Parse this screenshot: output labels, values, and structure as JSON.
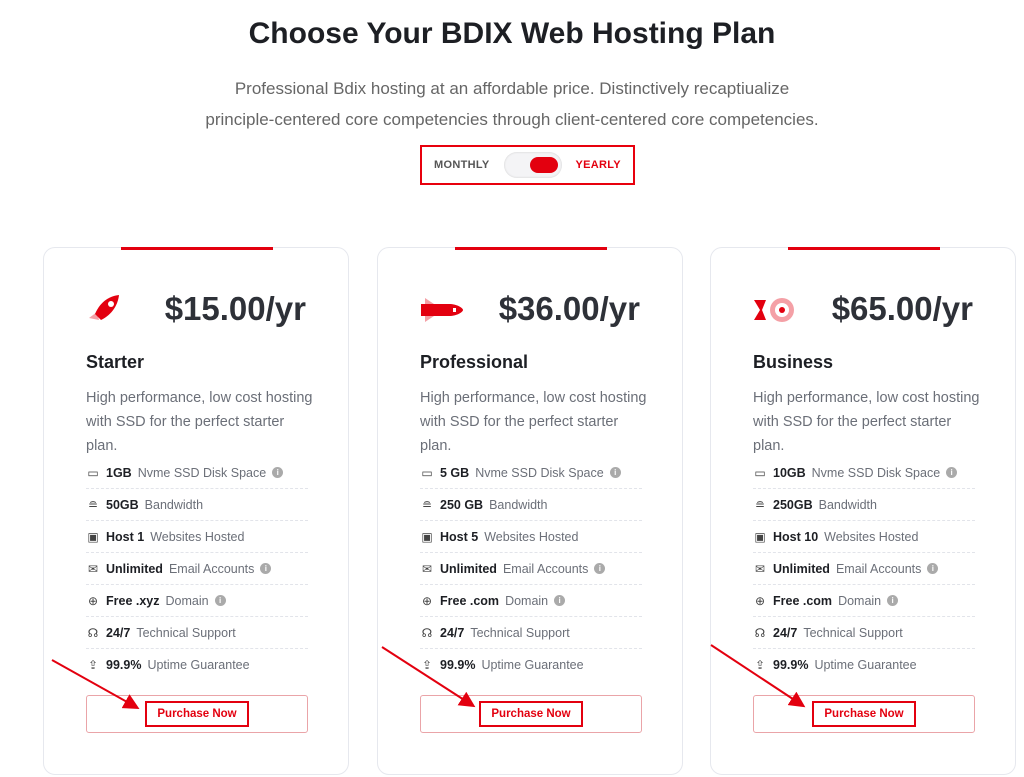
{
  "header": {
    "title": "Choose Your BDIX Web Hosting Plan",
    "subtitle_line1": "Professional Bdix hosting at an affordable price. Distinctively recaptiualize",
    "subtitle_line2": "principle-centered core competencies through client-centered core competencies."
  },
  "billing_toggle": {
    "monthly": "MONTHLY",
    "yearly": "YEARLY",
    "selected": "yearly"
  },
  "colors": {
    "accent": "#e3000f",
    "text": "#1d1f24",
    "muted": "#6b6f78"
  },
  "plans": [
    {
      "icon": "rocket-icon",
      "price": "$15.00/yr",
      "name": "Starter",
      "description": "High performance, low cost hosting with SSD for the perfect starter plan.",
      "features": [
        {
          "icon": "disk-icon",
          "bold": "1GB",
          "text": "Nvme SSD Disk Space",
          "info": true
        },
        {
          "icon": "router-icon",
          "bold": "50GB",
          "text": "Bandwidth",
          "info": false
        },
        {
          "icon": "browser-window-icon",
          "bold": "Host 1",
          "text": "Websites Hosted",
          "info": false
        },
        {
          "icon": "email-icon",
          "bold": "Unlimited",
          "text": "Email Accounts",
          "info": true
        },
        {
          "icon": "globe-icon",
          "bold": "Free .xyz",
          "text": "Domain",
          "info": true
        },
        {
          "icon": "headset-icon",
          "bold": "24/7",
          "text": "Technical Support",
          "info": false
        },
        {
          "icon": "upload-icon",
          "bold": "99.9%",
          "text": "Uptime Guarantee",
          "info": false
        }
      ],
      "button": "Purchase Now"
    },
    {
      "icon": "bullet-rocket-icon",
      "price": "$36.00/yr",
      "name": "Professional",
      "description": "High performance, low cost hosting with SSD for the perfect starter plan.",
      "features": [
        {
          "icon": "disk-icon",
          "bold": "5 GB",
          "text": "Nvme SSD Disk Space",
          "info": true
        },
        {
          "icon": "router-icon",
          "bold": "250 GB",
          "text": "Bandwidth",
          "info": false
        },
        {
          "icon": "browser-window-icon",
          "bold": "Host 5",
          "text": "Websites Hosted",
          "info": false
        },
        {
          "icon": "email-icon",
          "bold": "Unlimited",
          "text": "Email Accounts",
          "info": true
        },
        {
          "icon": "globe-icon",
          "bold": "Free .com",
          "text": "Domain",
          "info": true
        },
        {
          "icon": "headset-icon",
          "bold": "24/7",
          "text": "Technical Support",
          "info": false
        },
        {
          "icon": "upload-icon",
          "bold": "99.9%",
          "text": "Uptime Guarantee",
          "info": false
        }
      ],
      "button": "Purchase Now"
    },
    {
      "icon": "target-icon",
      "price": "$65.00/yr",
      "name": "Business",
      "description": "High performance, low cost hosting with SSD for the perfect starter plan.",
      "features": [
        {
          "icon": "disk-icon",
          "bold": "10GB",
          "text": "Nvme SSD Disk Space",
          "info": true
        },
        {
          "icon": "router-icon",
          "bold": "250GB",
          "text": "Bandwidth",
          "info": false
        },
        {
          "icon": "browser-window-icon",
          "bold": "Host 10",
          "text": "Websites Hosted",
          "info": false
        },
        {
          "icon": "email-icon",
          "bold": "Unlimited",
          "text": "Email Accounts",
          "info": true
        },
        {
          "icon": "globe-icon",
          "bold": "Free .com",
          "text": "Domain",
          "info": true
        },
        {
          "icon": "headset-icon",
          "bold": "24/7",
          "text": "Technical Support",
          "info": false
        },
        {
          "icon": "upload-icon",
          "bold": "99.9%",
          "text": "Uptime Guarantee",
          "info": false
        }
      ],
      "button": "Purchase Now"
    }
  ]
}
